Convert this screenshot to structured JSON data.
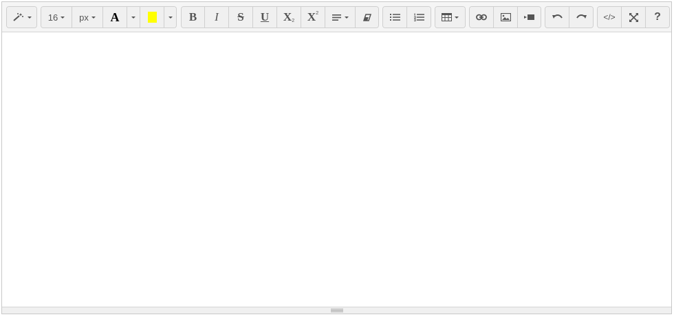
{
  "toolbar": {
    "style": {
      "icon": "magic-wand-icon"
    },
    "font_size": {
      "value": "16",
      "unit": "px"
    },
    "font_color": {
      "letter": "A",
      "text_color": "#000000",
      "highlight_color": "#ffff00"
    },
    "format": {
      "bold": "B",
      "italic": "I",
      "strikethrough": "S",
      "underline": "U",
      "subscript": "X",
      "subscript_mark": "2",
      "superscript": "X",
      "superscript_mark": "2"
    },
    "paragraph": {
      "align_icon": "align-icon",
      "clear_icon": "eraser-icon"
    },
    "lists": {
      "unordered_icon": "unordered-list-icon",
      "ordered_icon": "ordered-list-icon"
    },
    "table": {
      "icon": "table-icon"
    },
    "insert": {
      "link_icon": "link-icon",
      "picture_icon": "picture-icon",
      "video_icon": "video-icon"
    },
    "history": {
      "undo_icon": "undo-icon",
      "redo_icon": "redo-icon"
    },
    "view": {
      "code_label": "</>",
      "fullscreen_icon": "fullscreen-icon",
      "help_label": "?"
    }
  },
  "editor": {
    "content": ""
  },
  "colors": {
    "toolbar_bg": "#f5f5f5",
    "button_bg": "#f0f0f0",
    "border": "#cfcfcf",
    "icon": "#555555"
  }
}
